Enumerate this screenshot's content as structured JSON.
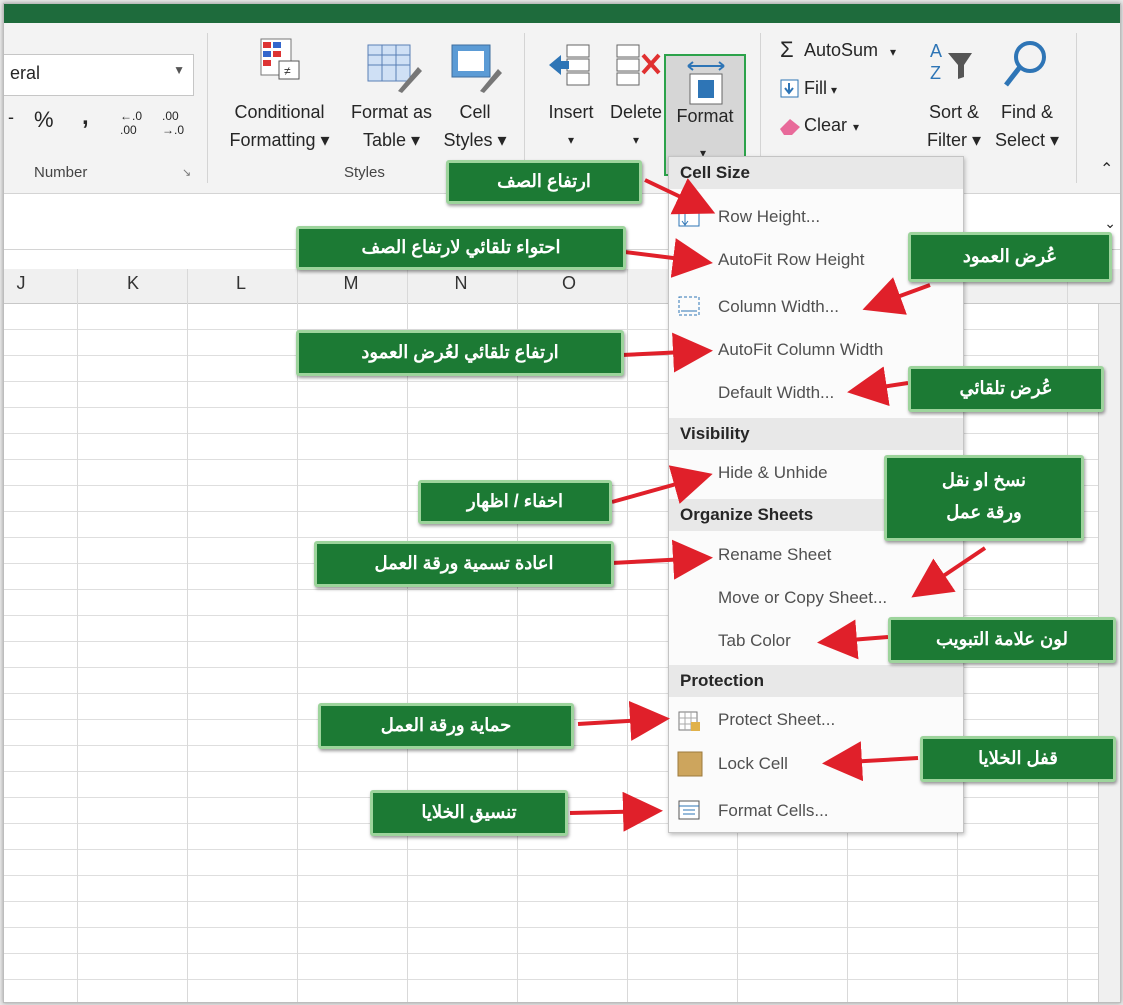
{
  "ribbon": {
    "number_format_value": "eral",
    "percent": "%",
    "comma": ",",
    "inc_decimal": "⁺.0",
    "dec_decimal": ".00",
    "number_group": "Number",
    "styles_group": "Styles",
    "conditional_formatting": [
      "Conditional",
      "Formatting ▾"
    ],
    "format_as_table": [
      "Format as",
      "Table ▾"
    ],
    "cell_styles": [
      "Cell",
      "Styles ▾"
    ],
    "insert": "Insert",
    "delete": "Delete",
    "format": "Format",
    "autosum": "AutoSum",
    "fill": "Fill",
    "clear": "Clear",
    "sort_filter": [
      "Sort &",
      "Filter ▾"
    ],
    "find_select": [
      "Find &",
      "Select ▾"
    ]
  },
  "columns": [
    "J",
    "K",
    "L",
    "M",
    "N",
    "O"
  ],
  "menu": {
    "cell_size_header": "Cell Size",
    "row_height": "Row Height...",
    "autofit_row_height": "AutoFit Row Height",
    "column_width": "Column Width...",
    "autofit_column_width": "AutoFit Column Width",
    "default_width": "Default Width...",
    "visibility_header": "Visibility",
    "hide_unhide": "Hide & Unhide",
    "organize_header": "Organize Sheets",
    "rename_sheet": "Rename Sheet",
    "move_copy_sheet": "Move or Copy Sheet...",
    "tab_color": "Tab Color",
    "protection_header": "Protection",
    "protect_sheet": "Protect Sheet...",
    "lock_cell": "Lock Cell",
    "format_cells": "Format Cells..."
  },
  "callouts": {
    "row_height": "ارتفاع الصف",
    "autofit_row": "احتواء تلقائي لارتفاع الصف",
    "column_width": "عُرض العمود",
    "autofit_column": "ارتفاع تلقائي لعُرض العمود",
    "default_width": "عُرض تلقائي",
    "hide_show": "اخفاء / اظهار",
    "move_copy": [
      "نسخ او نقل",
      "ورقة عمل"
    ],
    "rename": "اعادة تسمية ورقة العمل",
    "tab_color": "لون علامة التبويب",
    "protect_sheet": "حماية ورقة العمل",
    "lock_cells": "قفل الخلايا",
    "format_cells": "تنسيق الخلايا"
  },
  "colors": {
    "excel_green": "#1e6b3c",
    "callout_green": "#1c7a34",
    "callout_border": "#9dd49c",
    "arrow_red": "#e0202a",
    "highlight": "#2ca24a"
  },
  "icons": [
    "sigma-icon",
    "fill-down-icon",
    "eraser-icon",
    "sort-az-icon",
    "magnifier-icon",
    "conditional-formatting-icon",
    "format-as-table-icon",
    "cell-styles-icon",
    "insert-cells-icon",
    "delete-cells-icon",
    "format-icon",
    "row-height-icon",
    "column-width-icon",
    "protect-sheet-icon",
    "lock-cell-icon",
    "format-cells-icon"
  ]
}
